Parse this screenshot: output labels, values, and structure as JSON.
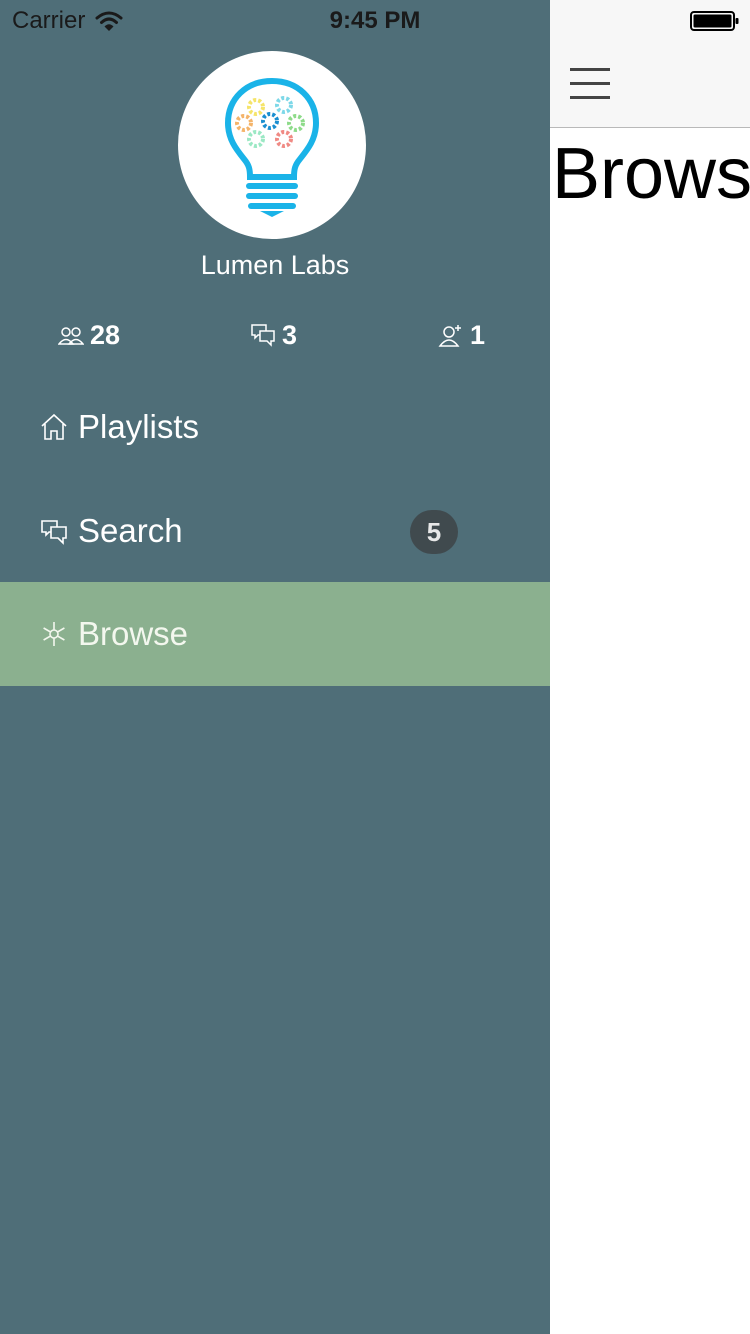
{
  "status_bar": {
    "carrier": "Carrier",
    "time": "9:45 PM"
  },
  "profile": {
    "name": "Lumen Labs",
    "logo_icon": "lightbulb-gears-icon"
  },
  "stats": [
    {
      "icon": "members-icon",
      "value": "28"
    },
    {
      "icon": "chat-icon",
      "value": "3"
    },
    {
      "icon": "add-user-icon",
      "value": "1"
    }
  ],
  "nav": {
    "items": [
      {
        "label": "Playlists",
        "icon": "home-icon",
        "selected": false
      },
      {
        "label": "Search",
        "icon": "chat-icon",
        "badge": "5",
        "selected": false
      },
      {
        "label": "Browse",
        "icon": "asterisk-icon",
        "selected": true
      }
    ]
  },
  "main": {
    "title": "Brows",
    "menu_icon": "hamburger-icon"
  },
  "colors": {
    "drawer_bg": "#4f6e78",
    "selected_item_bg": "#8bb08f",
    "badge_bg": "#404a4e",
    "navbar_bg": "#f7f7f7",
    "logo_blue": "#1ab3e8"
  }
}
